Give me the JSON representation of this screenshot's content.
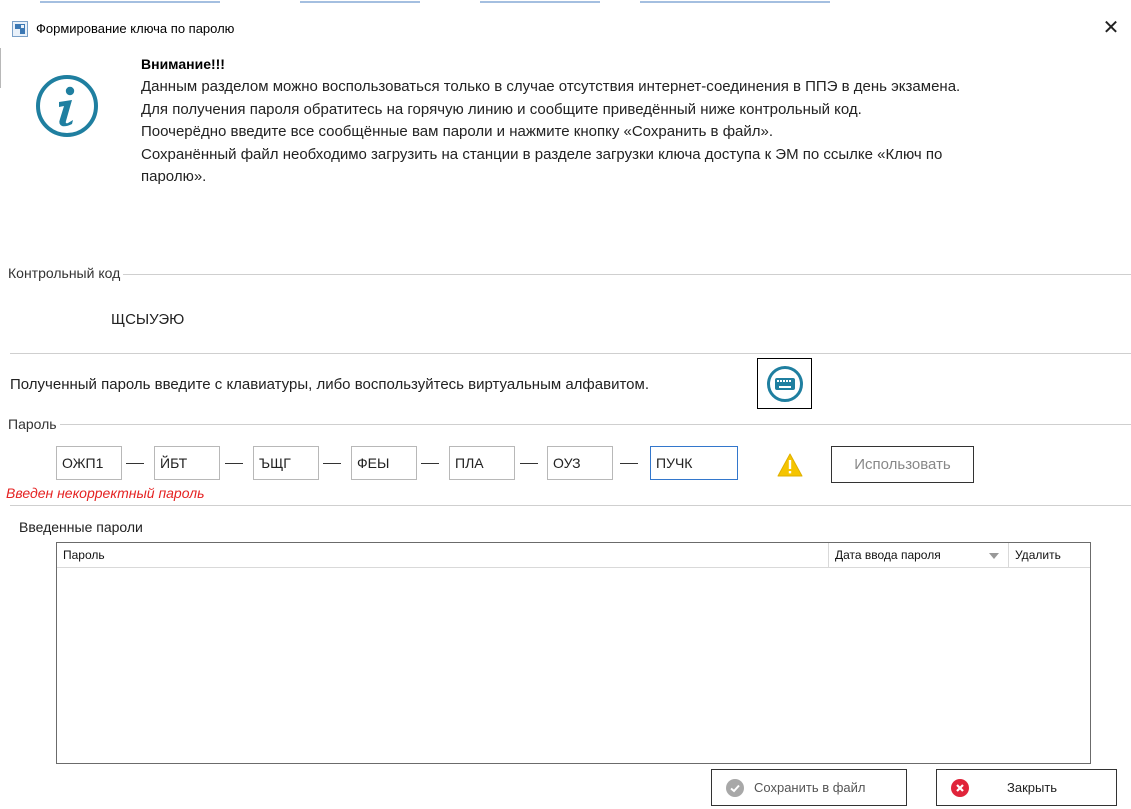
{
  "window": {
    "title": "Формирование ключа по паролю",
    "close_glyph": "✕"
  },
  "warning": {
    "heading": "Внимание!!!",
    "lines": [
      "Данным разделом можно воспользоваться только в случае отсутствия интернет-соединения в ППЭ в день экзамена.",
      "Для получения пароля обратитесь на горячую линию и сообщите приведённый ниже контрольный код.",
      "Поочерёдно введите все сообщённые вам пароли и нажмите кнопку «Сохранить в файл».",
      "Сохранённый файл необходимо загрузить на станции в разделе загрузки ключа доступа к ЭМ по ссылке «Ключ по",
      "паролю»."
    ],
    "icon": "info-icon"
  },
  "control_code": {
    "label": "Контрольный код",
    "value": "ЩСЫУЭЮ"
  },
  "hint": "Полученный пароль введите с клавиатуры, либо воспользуйтесь виртуальным алфавитом.",
  "keyboard_icon": "keyboard-icon",
  "password": {
    "label": "Пароль",
    "segments": [
      "ОЖП1",
      "ЙБТ",
      "ЪЩГ",
      "ФЕЫ",
      "ПЛА",
      "ОУЗ",
      "ПУЧК"
    ],
    "use_button": "Использовать",
    "error": "Введен некорректный пароль",
    "warning_icon": "warning-icon"
  },
  "entered": {
    "label": "Введенные пароли",
    "columns": [
      "Пароль",
      "Дата ввода пароля",
      "Удалить"
    ],
    "rows": []
  },
  "buttons": {
    "save": "Сохранить в файл",
    "close": "Закрыть"
  },
  "colors": {
    "accent": "#1f7fa0",
    "error": "#e52222",
    "warning": "#f5c400",
    "close_icon": "#e0243a",
    "save_icon": "#a8a8a8"
  }
}
